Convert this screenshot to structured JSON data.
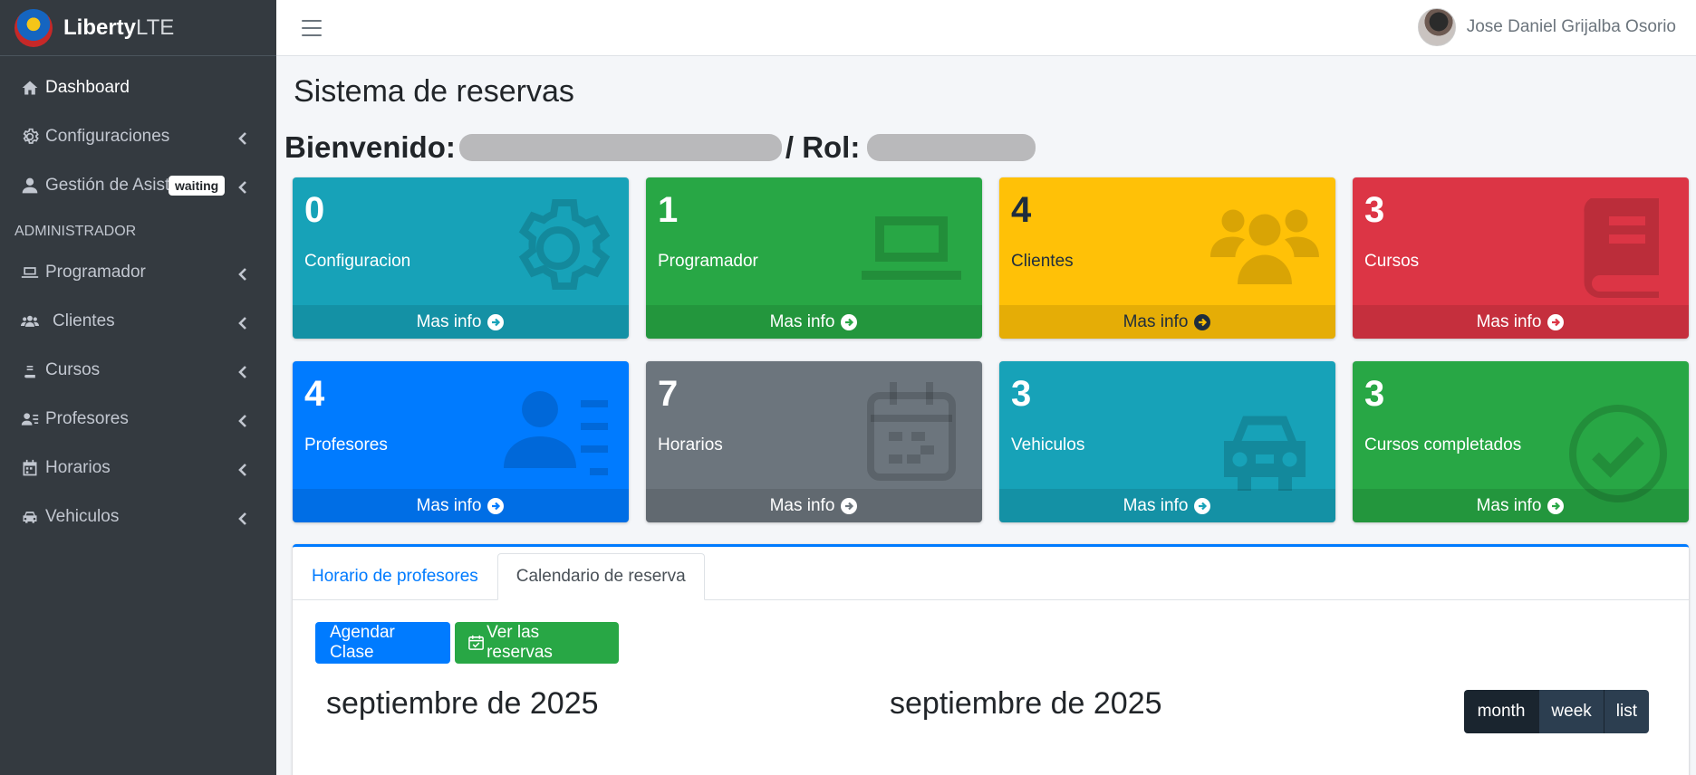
{
  "brand": {
    "bold": "Liberty",
    "light": "LTE"
  },
  "sidebar": {
    "items": [
      {
        "label": "Dashboard",
        "icon": "home-icon"
      },
      {
        "label": "Configuraciones",
        "icon": "gear-icon"
      },
      {
        "label": "Gestión de Asistencia",
        "icon": "user-icon",
        "badge": "waiting"
      }
    ],
    "section_header": "ADMINISTRADOR",
    "admin_items": [
      {
        "label": "Programador",
        "icon": "laptop-icon"
      },
      {
        "label": "Clientes",
        "icon": "users-icon"
      },
      {
        "label": "Cursos",
        "icon": "book-icon"
      },
      {
        "label": "Profesores",
        "icon": "address-card-icon"
      },
      {
        "label": "Horarios",
        "icon": "calendar-icon"
      },
      {
        "label": "Vehiculos",
        "icon": "car-icon"
      }
    ]
  },
  "topbar": {
    "user_name": "Jose Daniel Grijalba Osorio"
  },
  "page": {
    "title": "Sistema de reservas",
    "welcome_label": "Bienvenido:",
    "role_label": "/ Rol:"
  },
  "boxes": [
    {
      "number": "0",
      "label": "Configuracion",
      "footer": "Mas info",
      "color": "#17a2b8",
      "icon": "gear-icon"
    },
    {
      "number": "1",
      "label": "Programador",
      "footer": "Mas info",
      "color": "#28a745",
      "icon": "laptop-icon"
    },
    {
      "number": "4",
      "label": "Clientes",
      "footer": "Mas info",
      "color": "#ffc107",
      "icon": "users-icon"
    },
    {
      "number": "3",
      "label": "Cursos",
      "footer": "Mas info",
      "color": "#dc3545",
      "icon": "book-icon"
    },
    {
      "number": "4",
      "label": "Profesores",
      "footer": "Mas info",
      "color": "#007bff",
      "icon": "address-card-icon"
    },
    {
      "number": "7",
      "label": "Horarios",
      "footer": "Mas info",
      "color": "#6c757d",
      "icon": "calendar-icon"
    },
    {
      "number": "3",
      "label": "Vehiculos",
      "footer": "Mas info",
      "color": "#17a2b8",
      "icon": "car-icon"
    },
    {
      "number": "3",
      "label": "Cursos completados",
      "footer": "Mas info",
      "color": "#28a745",
      "icon": "check-circle-icon"
    }
  ],
  "card": {
    "tabs": [
      {
        "label": "Horario de profesores"
      },
      {
        "label": "Calendario de reserva"
      }
    ],
    "buttons": {
      "agendar": "Agendar Clase",
      "ver": "Ver las reservas"
    },
    "calendar_title_left": "septiembre de 2025",
    "calendar_title_center": "septiembre de 2025",
    "views": [
      "month",
      "week",
      "list"
    ]
  }
}
